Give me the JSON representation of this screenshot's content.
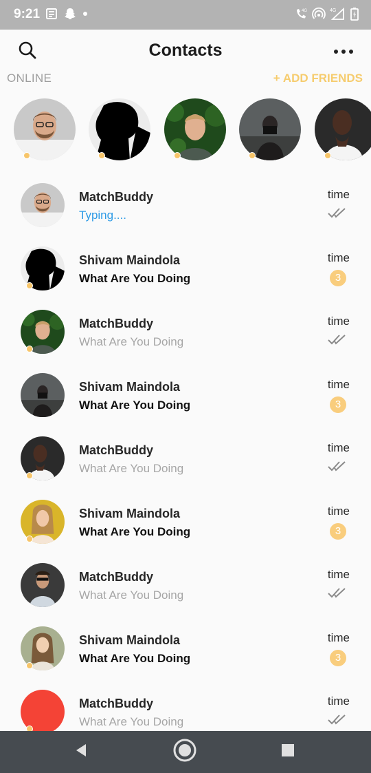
{
  "status_bar": {
    "time": "9:21",
    "left_icons": [
      "news-icon",
      "snapchat-icon",
      "dot-icon"
    ],
    "right_icons": [
      "volte-call-icon",
      "hotspot-icon",
      "signal-4g-icon",
      "battery-icon"
    ],
    "network_label": "4G"
  },
  "header": {
    "title": "Contacts",
    "search_icon": "search-icon",
    "more_icon": "more-horizontal-icon"
  },
  "online": {
    "label": "ONLINE",
    "add_friends": "+ ADD FRIENDS",
    "accent_color": "#f6cc6e"
  },
  "stories": [
    {
      "avatar": "man-glasses",
      "online": true
    },
    {
      "avatar": "silhouette",
      "online": true
    },
    {
      "avatar": "man-green-leaves",
      "online": true
    },
    {
      "avatar": "man-camera",
      "online": true
    },
    {
      "avatar": "man-white-shirt",
      "online": true
    }
  ],
  "chats": [
    {
      "name": "MatchBuddy",
      "message": "Typing....",
      "state": "typing",
      "time": "time",
      "unread": "",
      "avatar": "man-glasses"
    },
    {
      "name": "Shivam Maindola",
      "message": "What Are You Doing",
      "state": "unread",
      "time": "time",
      "unread": "3",
      "avatar": "silhouette"
    },
    {
      "name": "MatchBuddy",
      "message": "What Are You Doing",
      "state": "read",
      "time": "time",
      "unread": "",
      "avatar": "man-green-leaves"
    },
    {
      "name": "Shivam Maindola",
      "message": "What Are You Doing",
      "state": "unread",
      "time": "time",
      "unread": "3",
      "avatar": "man-camera"
    },
    {
      "name": "MatchBuddy",
      "message": "What Are You Doing",
      "state": "read",
      "time": "time",
      "unread": "",
      "avatar": "man-white-shirt"
    },
    {
      "name": "Shivam Maindola",
      "message": "What Are You Doing",
      "state": "unread",
      "time": "time",
      "unread": "3",
      "avatar": "woman-yellow"
    },
    {
      "name": "MatchBuddy",
      "message": "What Are You Doing",
      "state": "read",
      "time": "time",
      "unread": "",
      "avatar": "man-sunglasses"
    },
    {
      "name": "Shivam Maindola",
      "message": "What Are You Doing",
      "state": "unread",
      "time": "time",
      "unread": "3",
      "avatar": "woman-outdoor"
    },
    {
      "name": "MatchBuddy",
      "message": "What Are You Doing",
      "state": "read",
      "time": "time",
      "unread": "",
      "avatar": "red-placeholder"
    }
  ],
  "colors": {
    "typing": "#2e9be6",
    "badge": "#f9cd7d",
    "online_dot": "#f7c56a",
    "read_text": "#a6a6a6"
  },
  "nav_bar": {
    "icons": [
      "back-icon",
      "home-icon",
      "recents-icon"
    ]
  }
}
